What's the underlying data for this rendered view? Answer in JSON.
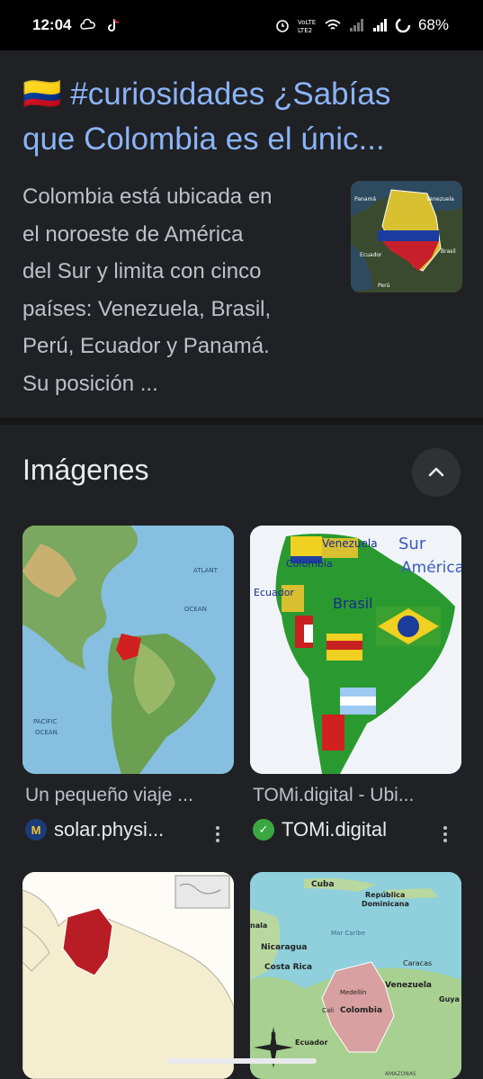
{
  "status_bar": {
    "time": "12:04",
    "battery": "68%",
    "icons": [
      "cloud-icon",
      "tiktok-icon",
      "alarm-icon",
      "volte-icon",
      "wifi-icon",
      "signal-icon",
      "signal-icon",
      "battery-icon"
    ]
  },
  "result": {
    "title_line1": "🇨🇴 #curiosidades ¿Sabías",
    "title_line2": "que Colombia es el únic...",
    "snippet_lines": [
      "Colombia está ubicada en",
      "el noroeste de América",
      "del Sur y limita con cinco",
      "países: Venezuela, Brasil,",
      "Perú, Ecuador y Panamá.",
      "Su posición ..."
    ],
    "thumb_labels": [
      "Panamá",
      "Venezuela",
      "Ecuador",
      "Brasil",
      "Perú"
    ]
  },
  "images": {
    "header": "Imágenes",
    "cards": [
      {
        "title": "Un pequeño viaje ...",
        "source": "solar.physi...",
        "source_icon_letter": "M",
        "map_labels": [
          "ATLANT",
          "OCEAN",
          "PACIFIC",
          "OCEAN"
        ]
      },
      {
        "title": "TOMi.digital - Ubi...",
        "source": "TOMi.digital",
        "source_icon_letter": "✓",
        "map_labels": [
          "Venezuela",
          "Colombia",
          "Sur",
          "América",
          "Ecuador",
          "Brasil"
        ]
      },
      {
        "title": "",
        "source": "",
        "map_labels": []
      },
      {
        "title": "",
        "source": "",
        "map_labels": [
          "Cuba",
          "República",
          "Dominicana",
          "Mar Caribe",
          "Nicaragua",
          "Costa Rica",
          "Caracas",
          "Venezuela",
          "Medellín",
          "Colombia",
          "Cali",
          "Ecuador",
          "Guya",
          "nala",
          "AMAZONAS"
        ]
      }
    ]
  },
  "colors": {
    "background": "#202124",
    "link": "#8ab4f8",
    "text": "#bdc1c6"
  }
}
